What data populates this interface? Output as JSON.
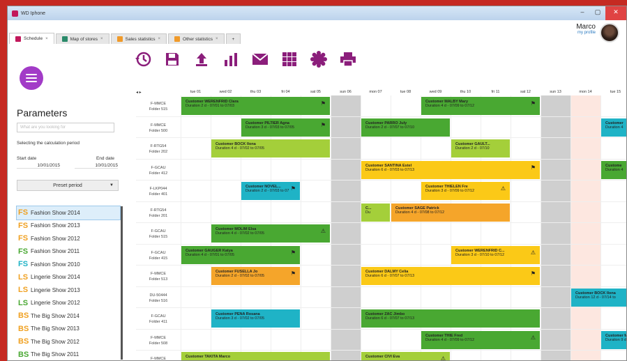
{
  "app": {
    "title": "WD Iphone"
  },
  "tabs": [
    {
      "label": "Schedule",
      "color": "#c2185b"
    },
    {
      "label": "Map of stores",
      "color": "#2a8a6a"
    },
    {
      "label": "Sales statistics",
      "color": "#f09a2a"
    },
    {
      "label": "Other statistics",
      "color": "#f09a2a"
    }
  ],
  "user": {
    "name": "Marco",
    "profile": "my profile"
  },
  "sidebar": {
    "title": "Parameters",
    "search_placeholder": "What are you looking for",
    "calc_label": "Selecting the calculation period",
    "start_label": "Start date",
    "end_label": "End date",
    "start_value": "10/01/2015",
    "end_value": "10/01/2015",
    "preset_label": "Preset period"
  },
  "shows": [
    {
      "label": "Fashion Show 2014",
      "icon": "FS",
      "color": "#f0a020"
    },
    {
      "label": "Fashion Show 2013",
      "icon": "FS",
      "color": "#f0a020"
    },
    {
      "label": "Fashion Show 2012",
      "icon": "FS",
      "color": "#f0a020"
    },
    {
      "label": "Fashion Show 2011",
      "icon": "FS",
      "color": "#49a832"
    },
    {
      "label": "Fashion Show 2010",
      "icon": "FS",
      "color": "#1fb3c6"
    },
    {
      "label": "Lingerie Show 2014",
      "icon": "LS",
      "color": "#f0a020"
    },
    {
      "label": "Lingerie Show 2013",
      "icon": "LS",
      "color": "#f0a020"
    },
    {
      "label": "Lingerie Show 2012",
      "icon": "LS",
      "color": "#49a832"
    },
    {
      "label": "The Big Show 2014",
      "icon": "BS",
      "color": "#f0a020"
    },
    {
      "label": "The Big Show 2013",
      "icon": "BS",
      "color": "#f0a020"
    },
    {
      "label": "The Big Show 2012",
      "icon": "BS",
      "color": "#f0a020"
    },
    {
      "label": "The Big Show 2011",
      "icon": "BS",
      "color": "#49a832"
    }
  ],
  "timeline": {
    "days": [
      "tue 01",
      "wed 02",
      "thu 03",
      "fri 04",
      "sat 05",
      "sun 06",
      "mon 07",
      "tue 08",
      "wed 09",
      "thu 10",
      "fri 11",
      "sat 12",
      "sun 13",
      "mon 14",
      "tue 15"
    ]
  },
  "rows": [
    {
      "code": "F-MMCE",
      "folder": "Folder 515"
    },
    {
      "code": "F-MMCE",
      "folder": "Folder 500"
    },
    {
      "code": "F-RTG54",
      "folder": "Folder 202"
    },
    {
      "code": "F-GCAU",
      "folder": "Folder 412"
    },
    {
      "code": "F-LKP044",
      "folder": "Folder 401"
    },
    {
      "code": "F-RTG54",
      "folder": "Folder 201"
    },
    {
      "code": "F-GCAU",
      "folder": "Folder 515"
    },
    {
      "code": "F-GCAU",
      "folder": "Folder 415"
    },
    {
      "code": "F-MMCE",
      "folder": "Folder 513"
    },
    {
      "code": "DU-50444",
      "folder": "Folder 516"
    },
    {
      "code": "F-GCAU",
      "folder": "Folder 411"
    },
    {
      "code": "F-MMCE",
      "folder": "Folder 508"
    },
    {
      "code": "F-MMCE",
      "folder": ""
    }
  ],
  "bars": [
    {
      "row": 0,
      "start": 0,
      "span": 5,
      "color": "g",
      "title": "Customer WERENFRID Clara",
      "sub": "Duration 2 d - 07/01 to 07/03",
      "flag": "⚑"
    },
    {
      "row": 0,
      "start": 8,
      "span": 4,
      "color": "g",
      "title": "Customer MALBY Mary",
      "sub": "Duration 4 d - 07/09 to 07/12",
      "flag": "⚑"
    },
    {
      "row": 1,
      "start": 2,
      "span": 3,
      "color": "g",
      "title": "Customer PILTIER Agna",
      "sub": "Duration 3 d - 07/03 to 07/05",
      "flag": "⚑"
    },
    {
      "row": 1,
      "start": 6,
      "span": 3,
      "color": "g",
      "title": "Customer PARRO July",
      "sub": "Duration 2 d - 07/07 to 07/10",
      "flag": ""
    },
    {
      "row": 1,
      "start": 14,
      "span": 1,
      "color": "c",
      "title": "Customer",
      "sub": "Duration 4",
      "flag": ""
    },
    {
      "row": 2,
      "start": 1,
      "span": 4,
      "color": "lg",
      "title": "Customer BOCK Ilona",
      "sub": "Duration 4 d - 07/02 to 07/05",
      "flag": ""
    },
    {
      "row": 2,
      "start": 9,
      "span": 2,
      "color": "lg",
      "title": "Customer GAULT...",
      "sub": "Duration 2 d - 07/10",
      "flag": ""
    },
    {
      "row": 3,
      "start": 6,
      "span": 6,
      "color": "y",
      "title": "Customer SANTINA Estel",
      "sub": "Duration 6 d - 07/03 to 07/13",
      "flag": "⚑"
    },
    {
      "row": 3,
      "start": 14,
      "span": 1,
      "color": "g",
      "title": "Custome",
      "sub": "Duration 4",
      "flag": ""
    },
    {
      "row": 4,
      "start": 2,
      "span": 2,
      "color": "c",
      "title": "Customer NOVEL...",
      "sub": "Duration 2 d - 07/03 to 07",
      "flag": "⚑"
    },
    {
      "row": 4,
      "start": 8,
      "span": 3,
      "color": "y",
      "title": "Customer THIELEN Fre",
      "sub": "Duration 3 d - 07/09 to 07/12",
      "flag": "⚠"
    },
    {
      "row": 5,
      "start": 6,
      "span": 1,
      "color": "lg",
      "title": "C...",
      "sub": "Du",
      "flag": ""
    },
    {
      "row": 5,
      "start": 7,
      "span": 4,
      "color": "o",
      "title": "Customer SAGE Patrick",
      "sub": "Duration 4 d - 07/08 to 07/12",
      "flag": ""
    },
    {
      "row": 6,
      "start": 1,
      "span": 4,
      "color": "g",
      "title": "Customer MOLIM Elsa",
      "sub": "Duration 4 d - 07/02 to 07/05",
      "flag": "⚠"
    },
    {
      "row": 7,
      "start": 0,
      "span": 4,
      "color": "g",
      "title": "Customer GAUGER Katya",
      "sub": "Duration 4 d - 07/01 to 07/05",
      "flag": "⚑"
    },
    {
      "row": 7,
      "start": 9,
      "span": 3,
      "color": "y",
      "title": "Customer WERENFRID C...",
      "sub": "Duration 3 d - 07/10 to 07/12",
      "flag": "⚠"
    },
    {
      "row": 8,
      "start": 1,
      "span": 3,
      "color": "o",
      "title": "Customer FUSELLA Jo",
      "sub": "Duration 2 d - 07/02 to 07/05",
      "flag": "⚑"
    },
    {
      "row": 8,
      "start": 6,
      "span": 6,
      "color": "y",
      "title": "Customer DALMY Celia",
      "sub": "Duration 6 d - 07/07 to 07/13",
      "flag": "⚑"
    },
    {
      "row": 9,
      "start": 13,
      "span": 2,
      "color": "c",
      "title": "Customer BOCK Ilona",
      "sub": "Duration 12 d - 07/14 to",
      "flag": ""
    },
    {
      "row": 10,
      "start": 1,
      "span": 3,
      "color": "c",
      "title": "Customer PENA Rosana",
      "sub": "Duration 3 d - 07/02 to 07/05",
      "flag": ""
    },
    {
      "row": 10,
      "start": 6,
      "span": 6,
      "color": "g",
      "title": "Customer ZAC Jimbo",
      "sub": "Duration 6 d - 07/07 to 07/13",
      "flag": ""
    },
    {
      "row": 11,
      "start": 8,
      "span": 4,
      "color": "g",
      "title": "Customer THIE Fred",
      "sub": "Duration 4 d - 07/09 to 07/12",
      "flag": "⚠"
    },
    {
      "row": 11,
      "start": 14,
      "span": 1,
      "color": "c",
      "title": "Customer MAL",
      "sub": "Duration 9 d - 07/",
      "flag": ""
    },
    {
      "row": 12,
      "start": 0,
      "span": 5,
      "color": "lg",
      "title": "Customer TAKITA Marco",
      "sub": "",
      "flag": ""
    },
    {
      "row": 12,
      "start": 6,
      "span": 3,
      "color": "lg",
      "title": "Customer CIVI Eva",
      "sub": "",
      "flag": "⚠"
    }
  ]
}
